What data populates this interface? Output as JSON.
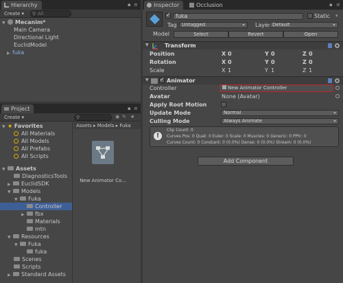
{
  "hierarchy": {
    "tab": "Hierarchy",
    "create": "Create",
    "search_placeholder": "All",
    "scene": "Mecanim*",
    "items": [
      "Main Camera",
      "Directional Light",
      "EuclidModel",
      "fuka"
    ]
  },
  "project": {
    "tab": "Project",
    "create": "Create",
    "favorites": {
      "label": "Favorites",
      "items": [
        "All Materials",
        "All Models",
        "All Prefabs",
        "All Scripts"
      ]
    },
    "assets": {
      "label": "Assets",
      "items": [
        {
          "label": "DiagnosticsTools",
          "depth": 1
        },
        {
          "label": "EuclidSDK",
          "depth": 1
        },
        {
          "label": "Models",
          "depth": 1
        },
        {
          "label": "Fuka",
          "depth": 2
        },
        {
          "label": "Controller",
          "depth": 3
        },
        {
          "label": "fbx",
          "depth": 3
        },
        {
          "label": "Materials",
          "depth": 3
        },
        {
          "label": "mtn",
          "depth": 3
        },
        {
          "label": "Resources",
          "depth": 1
        },
        {
          "label": "Fuka",
          "depth": 2
        },
        {
          "label": "fuka",
          "depth": 3
        },
        {
          "label": "Scenes",
          "depth": 1
        },
        {
          "label": "Scripts",
          "depth": 1
        },
        {
          "label": "Standard Assets",
          "depth": 1
        }
      ]
    },
    "breadcrumb": [
      "Assets",
      "Models",
      "Fuka"
    ],
    "asset_label": "New Animator Co..."
  },
  "inspector": {
    "tab": "Inspector",
    "tab2": "Occlusion",
    "name": "fuka",
    "static": "Static",
    "tag_label": "Tag",
    "tag": "Untagged",
    "layer_label": "Layer",
    "layer": "Default",
    "model_label": "Model",
    "select": "Select",
    "revert": "Revert",
    "open": "Open",
    "transform": {
      "title": "Transform",
      "rows": [
        {
          "label": "Position",
          "x": "0",
          "y": "0",
          "z": "0"
        },
        {
          "label": "Rotation",
          "x": "0",
          "y": "0",
          "z": "0"
        },
        {
          "label": "Scale",
          "x": "1",
          "y": "1",
          "z": "1"
        }
      ]
    },
    "animator": {
      "title": "Animator",
      "controller_label": "Controller",
      "controller": "New Animator Controller",
      "avatar_label": "Avatar",
      "avatar": "None (Avatar)",
      "apply_root": "Apply Root Motion",
      "update_label": "Update Mode",
      "update": "Normal",
      "culling_label": "Culling Mode",
      "culling": "Always Animate",
      "info1": "Clip Count: 0",
      "info2": "Curves Pos: 0 Quat: 0 Euler: 0 Scale: 0 Muscles: 0 Generic: 0 PPtr: 0",
      "info3": "Curves Count: 0 Constant: 0 (0.0%) Dense: 0 (0.0%) Stream: 0 (0.0%)"
    },
    "add_component": "Add Component"
  },
  "colors": {
    "selection": "#3e5f96",
    "highlight_border": "#c0262a",
    "folder": "#8a8a8a"
  }
}
